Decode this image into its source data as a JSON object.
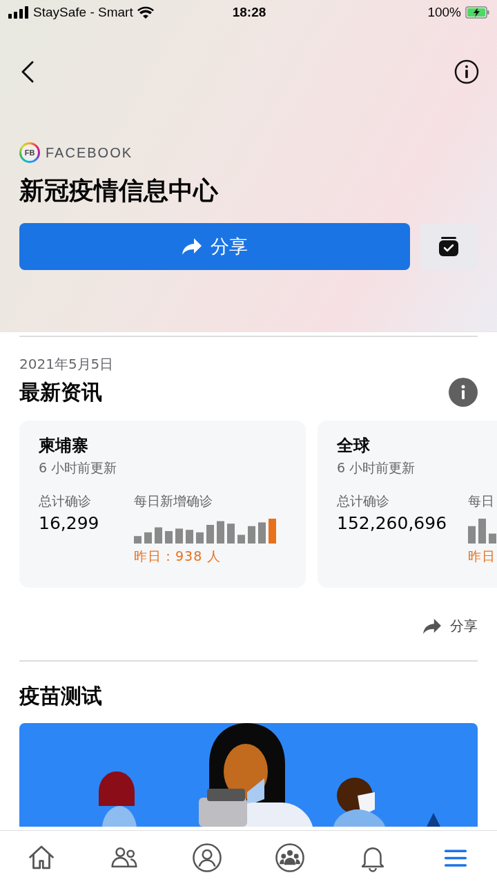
{
  "status_bar": {
    "carrier": "StaySafe - Smart",
    "time": "18:28",
    "battery": "100%"
  },
  "header": {
    "brand": "FACEBOOK",
    "logo": "FB",
    "title": "新冠疫情信息中心",
    "share_button": "分享"
  },
  "news": {
    "date": "2021年5月5日",
    "title": "最新资讯",
    "cards": [
      {
        "region": "柬埔寨",
        "updated": "6 小时前更新",
        "total_label": "总计确诊",
        "total": "16,299",
        "daily_label": "每日新增确诊",
        "yesterday": "昨日：938 人"
      },
      {
        "region": "全球",
        "updated": "6 小时前更新",
        "total_label": "总计确诊",
        "total": "152,260,696",
        "daily_label": "每日",
        "yesterday": "昨日"
      }
    ],
    "share_link": "分享"
  },
  "vaccine": {
    "title": "疫苗测试"
  },
  "tab_bar": [
    {
      "kind": "home",
      "selected": false
    },
    {
      "kind": "friends",
      "selected": false
    },
    {
      "kind": "profile",
      "selected": false
    },
    {
      "kind": "groups",
      "selected": false
    },
    {
      "kind": "notifications",
      "selected": false
    },
    {
      "kind": "menu",
      "selected": true
    }
  ]
}
